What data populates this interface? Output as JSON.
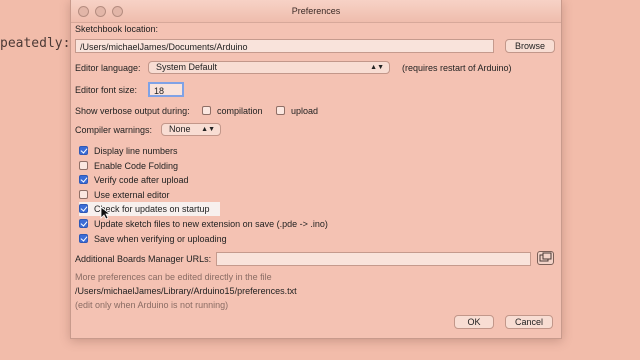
{
  "background": {
    "code_fragment": "peatedly:"
  },
  "window": {
    "title": "Preferences"
  },
  "sketchbook": {
    "label": "Sketchbook location:",
    "value": "/Users/michaelJames/Documents/Arduino",
    "browse_label": "Browse"
  },
  "language": {
    "label": "Editor language:",
    "value": "System Default",
    "note": "(requires restart of Arduino)"
  },
  "font_size": {
    "label": "Editor font size:",
    "value": "18"
  },
  "verbose": {
    "label": "Show verbose output during:",
    "compilation": {
      "label": "compilation",
      "checked": false
    },
    "upload": {
      "label": "upload",
      "checked": false
    }
  },
  "warnings": {
    "label": "Compiler warnings:",
    "value": "None"
  },
  "options": [
    {
      "label": "Display line numbers",
      "checked": true
    },
    {
      "label": "Enable Code Folding",
      "checked": false
    },
    {
      "label": "Verify code after upload",
      "checked": true
    },
    {
      "label": "Use external editor",
      "checked": false
    },
    {
      "label": "Check for updates on startup",
      "checked": true
    },
    {
      "label": "Update sketch files to new extension on save (.pde -> .ino)",
      "checked": true
    },
    {
      "label": "Save when verifying or uploading",
      "checked": true
    }
  ],
  "boards": {
    "label": "Additional Boards Manager URLs:",
    "value": ""
  },
  "footer": {
    "info": "More preferences can be edited directly in the file",
    "path": "/Users/michaelJames/Library/Arduino15/preferences.txt",
    "hint": "(edit only when Arduino is not running)"
  },
  "buttons": {
    "ok": "OK",
    "cancel": "Cancel"
  },
  "colors": {
    "accent": "#3b6cd6",
    "dialog": "#f4c2b3",
    "background": "#f2bcaa"
  }
}
